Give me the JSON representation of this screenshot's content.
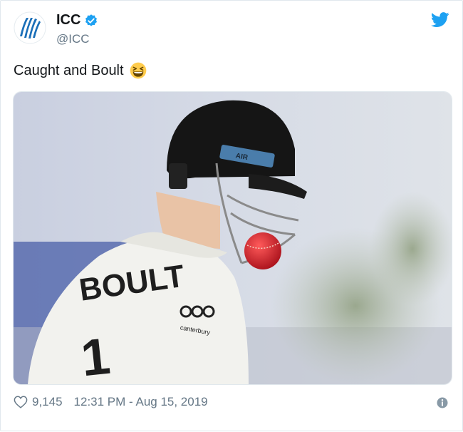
{
  "account": {
    "name": "ICC",
    "handle": "@ICC",
    "verified": true
  },
  "tweet": {
    "text": "Caught and Boult",
    "emoji": "grinning-squinting-face"
  },
  "media": {
    "jersey_name": "BOULT",
    "sponsor": "canterbury",
    "helmet_label": "AIR"
  },
  "footer": {
    "likes": "9,145",
    "timestamp": "12:31 PM - Aug 15, 2019"
  },
  "colors": {
    "twitter_blue": "#1da1f2",
    "text": "#14171a",
    "meta": "#657786"
  }
}
